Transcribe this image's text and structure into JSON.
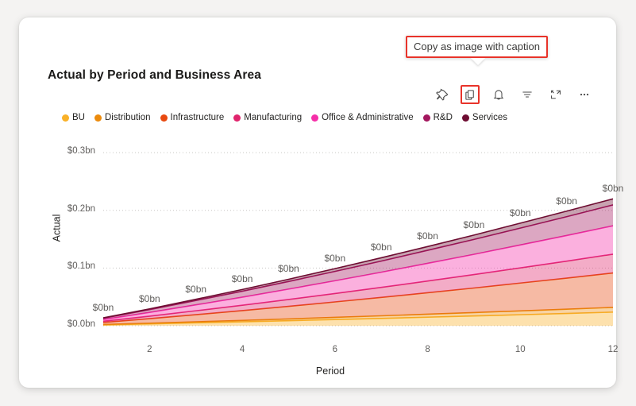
{
  "visual": {
    "title": "Actual by Period and Business Area"
  },
  "tooltip": {
    "text": "Copy as image with caption",
    "border_color": "#e8332a"
  },
  "toolbar": {
    "buttons": [
      {
        "name": "pin-icon",
        "label": "Pin",
        "active": false
      },
      {
        "name": "copy-icon",
        "label": "Copy as image with caption",
        "active": true
      },
      {
        "name": "bell-icon",
        "label": "Alerts",
        "active": false
      },
      {
        "name": "filter-icon",
        "label": "Filters",
        "active": false
      },
      {
        "name": "focus-mode-icon",
        "label": "Focus mode",
        "active": false
      },
      {
        "name": "more-options-icon",
        "label": "More options",
        "active": false
      }
    ]
  },
  "legend": {
    "items": [
      {
        "label": "BU",
        "color": "#f9b128"
      },
      {
        "label": "Distribution",
        "color": "#ec8b0c"
      },
      {
        "label": "Infrastructure",
        "color": "#e8490f"
      },
      {
        "label": "Manufacturing",
        "color": "#e0246d"
      },
      {
        "label": "Office & Administrative",
        "color": "#f52fa8"
      },
      {
        "label": "R&D",
        "color": "#a3175e"
      },
      {
        "label": "Services",
        "color": "#6e0d32"
      }
    ]
  },
  "chart_data": {
    "type": "area",
    "stacked": true,
    "title": "Actual by Period and Business Area",
    "xlabel": "Period",
    "ylabel": "Actual",
    "x": [
      1,
      2,
      3,
      4,
      5,
      6,
      7,
      8,
      9,
      10,
      11,
      12
    ],
    "xtick_labels": [
      "2",
      "4",
      "6",
      "8",
      "10",
      "12"
    ],
    "xticks": [
      2,
      4,
      6,
      8,
      10,
      12
    ],
    "xlim": [
      1,
      12
    ],
    "ytick_labels": [
      "$0.0bn",
      "$0.1bn",
      "$0.2bn",
      "$0.3bn"
    ],
    "yticks": [
      0,
      0.1,
      0.2,
      0.3
    ],
    "ylim": [
      0,
      0.325
    ],
    "grid": "horizontal-dotted",
    "legend_position": "top-left",
    "data_labels": {
      "text": "$0bn",
      "series": "total",
      "points": [
        {
          "x": 1,
          "label": "$0bn"
        },
        {
          "x": 2,
          "label": "$0bn"
        },
        {
          "x": 3,
          "label": "$0bn"
        },
        {
          "x": 4,
          "label": "$0bn"
        },
        {
          "x": 5,
          "label": "$0bn"
        },
        {
          "x": 6,
          "label": "$0bn"
        },
        {
          "x": 7,
          "label": "$0bn"
        },
        {
          "x": 8,
          "label": "$0bn"
        },
        {
          "x": 9,
          "label": "$0bn"
        },
        {
          "x": 10,
          "label": "$0bn"
        },
        {
          "x": 11,
          "label": "$0bn"
        },
        {
          "x": 12,
          "label": "$0bn"
        }
      ]
    },
    "series": [
      {
        "name": "BU",
        "color": "#f9b128",
        "values": [
          0.0015,
          0.0032,
          0.005,
          0.0068,
          0.0087,
          0.0107,
          0.0127,
          0.0148,
          0.0169,
          0.0191,
          0.0213,
          0.0236
        ]
      },
      {
        "name": "Distribution",
        "color": "#ec8b0c",
        "values": [
          0.0006,
          0.0012,
          0.0018,
          0.0024,
          0.0031,
          0.0038,
          0.0045,
          0.0052,
          0.0059,
          0.0067,
          0.0074,
          0.0082
        ]
      },
      {
        "name": "Infrastructure",
        "color": "#e8490f",
        "values": [
          0.0037,
          0.0079,
          0.0124,
          0.017,
          0.0218,
          0.0268,
          0.0319,
          0.0372,
          0.0426,
          0.0482,
          0.0539,
          0.0597
        ]
      },
      {
        "name": "Manufacturing",
        "color": "#e0246d",
        "values": [
          0.002,
          0.0043,
          0.0068,
          0.0093,
          0.0119,
          0.0146,
          0.0174,
          0.0203,
          0.0233,
          0.0263,
          0.0294,
          0.0326
        ]
      },
      {
        "name": "Office & Administrative",
        "color": "#f52fa8",
        "values": [
          0.003,
          0.0065,
          0.0102,
          0.014,
          0.018,
          0.0221,
          0.0263,
          0.0307,
          0.0351,
          0.0397,
          0.0444,
          0.0492
        ]
      },
      {
        "name": "R&D",
        "color": "#a3175e",
        "values": [
          0.0022,
          0.0048,
          0.0075,
          0.0103,
          0.0132,
          0.0162,
          0.0193,
          0.0225,
          0.0258,
          0.0292,
          0.0326,
          0.0361
        ]
      },
      {
        "name": "Services",
        "color": "#6e0d32",
        "values": [
          0.0007,
          0.0014,
          0.0022,
          0.003,
          0.0039,
          0.0048,
          0.0057,
          0.0066,
          0.0076,
          0.0086,
          0.0096,
          0.0106
        ]
      }
    ],
    "totals": [
      0.0137,
      0.0293,
      0.0459,
      0.0628,
      0.0806,
      0.099,
      0.1178,
      0.1373,
      0.1572,
      0.1778,
      0.1986,
      0.22
    ]
  }
}
